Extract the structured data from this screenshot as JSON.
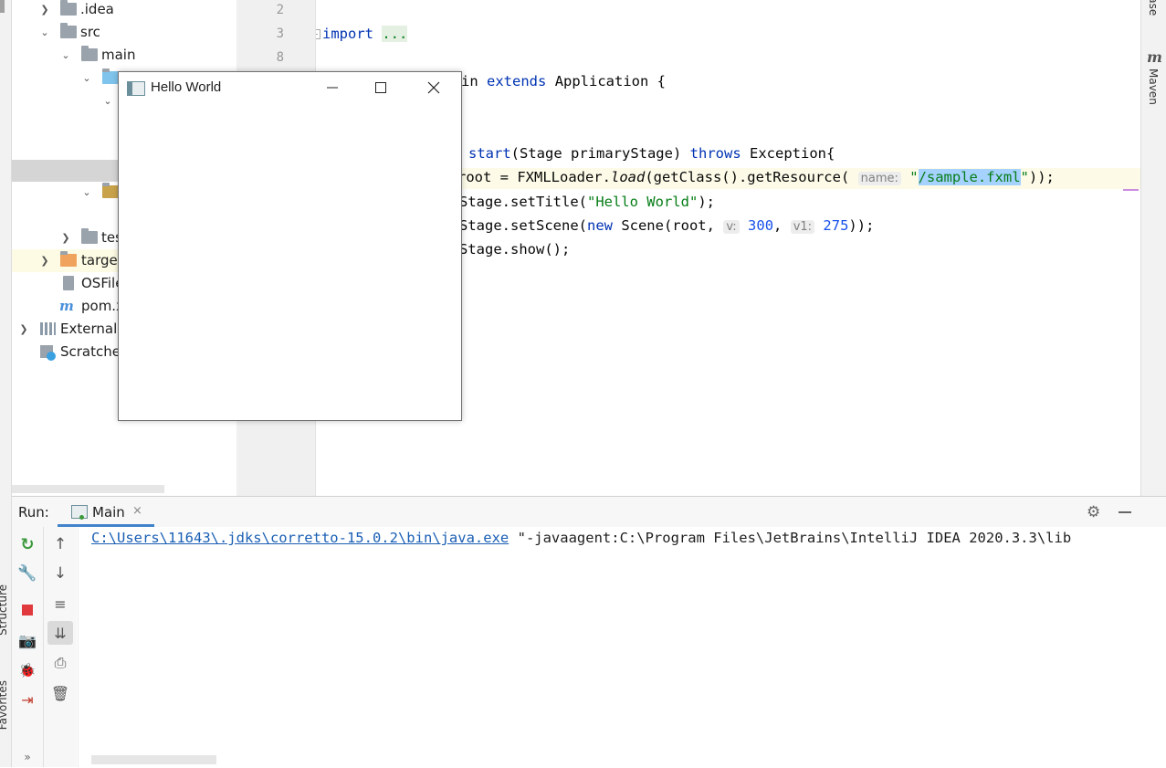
{
  "side_tabs": {
    "left_structure": "Structure",
    "left_favorites": "Favorites",
    "right_database": "Database",
    "right_maven": "Maven"
  },
  "project_tree": {
    "items": [
      {
        "label": ".idea",
        "icon": "folder-icon"
      },
      {
        "label": "src",
        "icon": "folder-icon"
      },
      {
        "label": "main",
        "icon": "folder-icon"
      },
      {
        "label": "tes",
        "icon": "folder-icon"
      },
      {
        "label": "target",
        "icon": "folder-icon"
      },
      {
        "label": "OSFile",
        "icon": "file-icon"
      },
      {
        "label": "pom.x",
        "icon": "maven-icon"
      },
      {
        "label": "External",
        "icon": "library-icon"
      },
      {
        "label": "Scratche",
        "icon": "scratch-icon"
      }
    ]
  },
  "gutter": {
    "line_numbers": [
      "2",
      "3",
      "8"
    ]
  },
  "editor": {
    "import_kw": "import",
    "import_fold": "...",
    "class_frag": "in",
    "extends_kw": "extends",
    "class_rest": "Application {",
    "method_name": "start",
    "method_params": "(Stage primaryStage)",
    "throws_kw": "throws",
    "method_rest": "Exception{",
    "l1_a": "root = FXMLLoader.",
    "l1_load": "load",
    "l1_b": "(getClass().getResource(",
    "l1_hint": "name:",
    "l1_q1": "\"",
    "l1_str": "/sample.fxml",
    "l1_q2": "\"",
    "l1_end": "));",
    "l2_a": "Stage.setTitle(",
    "l2_str": "\"Hello World\"",
    "l2_end": ");",
    "l3_a": "Stage.setScene(",
    "l3_new": "new",
    "l3_b": " Scene(root,",
    "l3_hint1": "v:",
    "l3_n1": "300",
    "l3_comma": ",",
    "l3_hint2": "v1:",
    "l3_n2": "275",
    "l3_end": "));",
    "l4": "Stage.show();"
  },
  "app_window": {
    "title": "Hello World",
    "buttons": [
      "minimize",
      "maximize",
      "close"
    ]
  },
  "run_panel": {
    "label": "Run:",
    "tab_label": "Main",
    "console_path": "C:\\Users\\11643\\.jdks\\corretto-15.0.2\\bin\\java.exe",
    "console_args": "\"-javaagent:C:\\Program Files\\JetBrains\\IntelliJ IDEA 2020.3.3\\lib",
    "colors": {
      "link": "#1a5fb4",
      "stop": "#e0393e",
      "rerun": "#3c9a3c"
    }
  }
}
